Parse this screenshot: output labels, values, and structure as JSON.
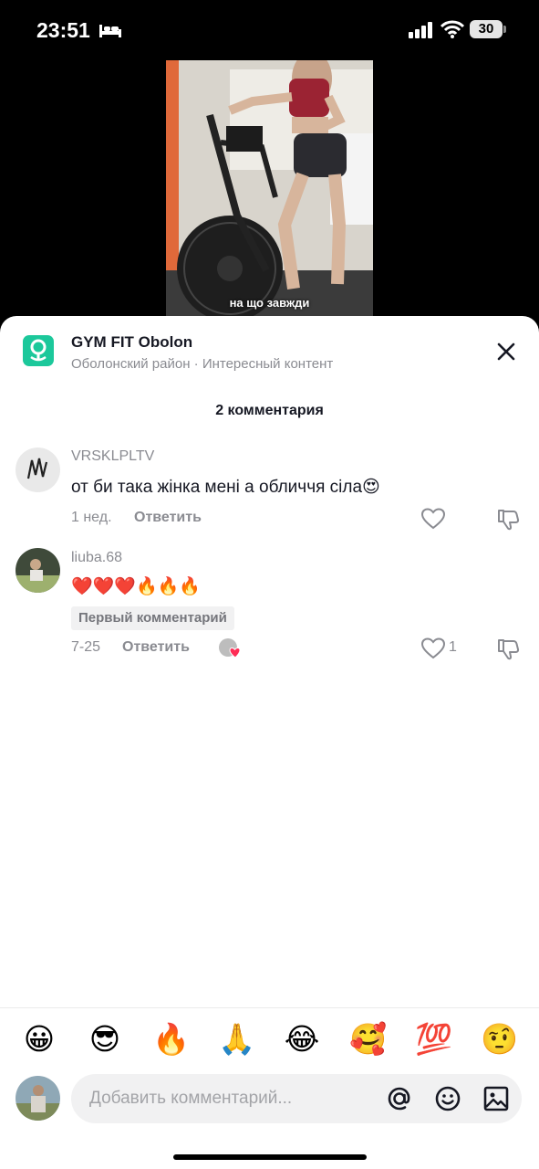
{
  "status_bar": {
    "time": "23:51",
    "battery": "30",
    "icons": [
      "bed-icon",
      "signal-icon",
      "wifi-icon",
      "battery-icon"
    ]
  },
  "video": {
    "caption": "на що завжди"
  },
  "location": {
    "title": "GYM FIT Obolon",
    "subtitle": "Оболонский район · Интересный контент",
    "icon": "location-pin-icon",
    "accent": "#1cc89b"
  },
  "comments_header": "2 комментария",
  "comments": [
    {
      "username": "VRSKLPLTV",
      "text": "от би така жінка мені а обличчя сіла😍",
      "time": "1 нед.",
      "reply_label": "Ответить",
      "likes": ""
    },
    {
      "username": "liuba.68",
      "text": "❤️❤️❤️🔥🔥🔥",
      "badge": "Первый комментарий",
      "time": "7-25",
      "reply_label": "Ответить",
      "likes": "1"
    }
  ],
  "emoji_bar": [
    "😀",
    "😎",
    "🔥",
    "🙏",
    "😂",
    "🥰",
    "💯",
    "🤨"
  ],
  "input": {
    "placeholder": "Добавить комментарий..."
  }
}
